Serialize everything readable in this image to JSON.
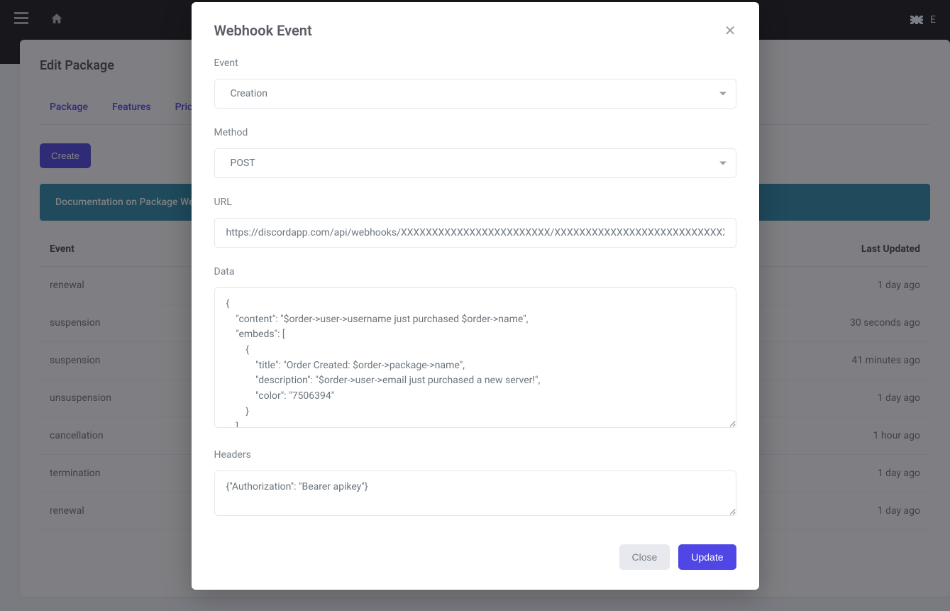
{
  "topbar": {
    "language_code": "E"
  },
  "page": {
    "title": "Edit Package",
    "tabs": [
      "Package",
      "Features",
      "Prices"
    ],
    "create_label": "Create",
    "docs_banner": "Documentation on Package Webhoo",
    "table": {
      "headers": {
        "event": "Event",
        "last_updated": "Last Updated"
      },
      "rows": [
        {
          "event": "renewal",
          "last_updated": "1 day ago"
        },
        {
          "event": "suspension",
          "last_updated": "30 seconds ago"
        },
        {
          "event": "suspension",
          "last_updated": "41 minutes ago"
        },
        {
          "event": "unsuspension",
          "last_updated": "1 day ago"
        },
        {
          "event": "cancellation",
          "last_updated": "1 hour ago"
        },
        {
          "event": "termination",
          "last_updated": "1 day ago"
        },
        {
          "event": "renewal",
          "last_updated": "1 day ago"
        }
      ]
    }
  },
  "modal": {
    "title": "Webhook Event",
    "labels": {
      "event": "Event",
      "method": "Method",
      "url": "URL",
      "data": "Data",
      "headers": "Headers"
    },
    "values": {
      "event": "Creation",
      "method": "POST",
      "url": "https://discordapp.com/api/webhooks/XXXXXXXXXXXXXXXXXXXXXXXX/XXXXXXXXXXXXXXXXXXXXXXXXXXXXXX",
      "data": "{\n    \"content\": \"$order->user->username just purchased $order->name\",\n    \"embeds\": [\n        {\n            \"title\": \"Order Created: $order->package->name\",\n            \"description\": \"$order->user->email just purchased a new server!\",\n            \"color\": \"7506394\"\n        }\n    ]",
      "headers": "{\"Authorization\": \"Bearer apikey\"}"
    },
    "buttons": {
      "close": "Close",
      "update": "Update"
    }
  }
}
